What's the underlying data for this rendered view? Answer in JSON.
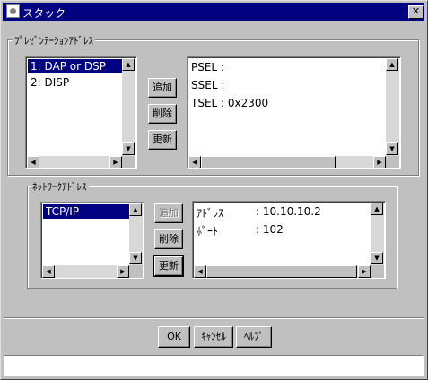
{
  "window": {
    "title": "スタック",
    "close_glyph": "✕"
  },
  "presentation": {
    "legend": "ﾌﾟﾚｾﾞﾝﾃｰｼｮﾝｱﾄﾞﾚｽ",
    "list": [
      {
        "label": "1: DAP or DSP",
        "selected": true
      },
      {
        "label": "2: DISP",
        "selected": false
      }
    ],
    "buttons": {
      "add": "追加",
      "delete": "削除",
      "update": "更新"
    },
    "info": [
      "PSEL :",
      "SSEL :",
      "TSEL : 0x2300"
    ]
  },
  "network": {
    "legend": "ﾈｯﾄﾜｰｸｱﾄﾞﾚｽ",
    "list": [
      {
        "label": "TCP/IP",
        "selected": true
      }
    ],
    "buttons": {
      "add": "追加",
      "delete": "削除",
      "update": "更新"
    },
    "info": [
      {
        "key": "ｱﾄﾞﾚｽ",
        "value": ": 10.10.10.2"
      },
      {
        "key": "ﾎﾟｰﾄ",
        "value": ": 102"
      }
    ]
  },
  "footer": {
    "ok": "OK",
    "cancel": "ｷｬﾝｾﾙ",
    "help": "ﾍﾙﾌﾟ",
    "status": ""
  },
  "icons": {
    "up": "▲",
    "down": "▼",
    "left": "◀",
    "right": "▶"
  },
  "colors": {
    "titlebar": "#000080",
    "selection": "#000080",
    "face": "#c0c0c0"
  }
}
